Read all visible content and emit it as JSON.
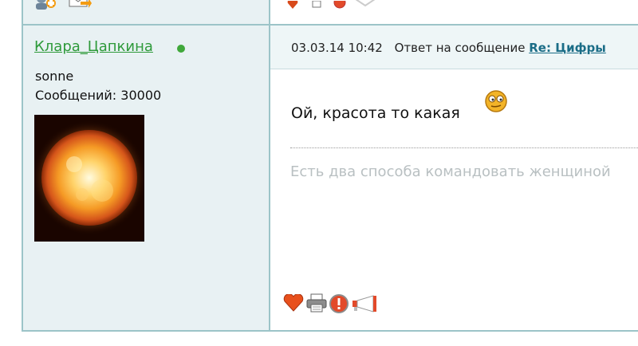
{
  "post": {
    "author": "Клара_Цапкина",
    "status_text": "sonne",
    "posts_label": "Сообщений:",
    "posts_count": "30000",
    "date": "03.03.14 10:42",
    "reply_prefix": "Ответ на сообщение",
    "reply_title": "Re: Цифры",
    "message": "Ой, красота то какая",
    "signature": "Есть два способа командовать женщиной"
  },
  "icons": {
    "top": [
      "add-user-icon",
      "email-icon",
      "heart-icon",
      "print-icon",
      "report-icon",
      "megaphone-icon"
    ],
    "actions": [
      "heart-icon",
      "print-icon",
      "report-icon",
      "megaphone-icon"
    ]
  },
  "colors": {
    "online": "#3fa83a",
    "border": "#9cc4c8",
    "username": "#2e9a3a",
    "link": "#1b6d87"
  }
}
